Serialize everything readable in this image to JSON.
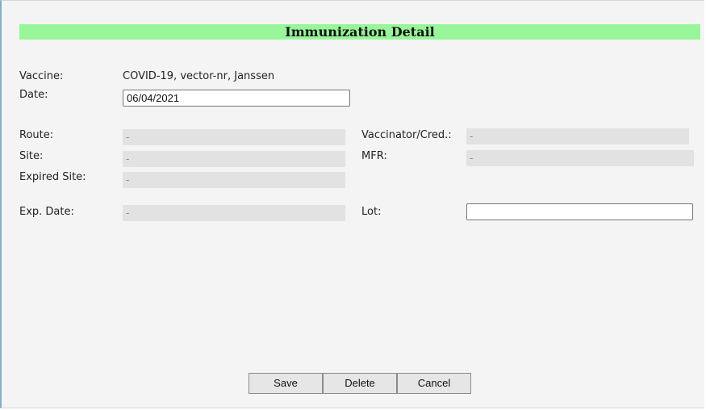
{
  "form": {
    "title": "Immunization Detail",
    "vaccine": {
      "label": "Vaccine:",
      "value": "COVID-19, vector-nr, Janssen"
    },
    "date": {
      "label": "Date:",
      "value": "06/04/2021"
    },
    "route": {
      "label": "Route:",
      "value": "-"
    },
    "site": {
      "label": "Site:",
      "value": "-"
    },
    "expired_site": {
      "label": "Expired Site:",
      "value": "-"
    },
    "exp_date": {
      "label": "Exp. Date:",
      "value": "-"
    },
    "vaccinator": {
      "label": "Vaccinator/Cred.:",
      "value": "-"
    },
    "mfr": {
      "label": "MFR:",
      "value": "-"
    },
    "lot": {
      "label": "Lot:",
      "value": ""
    }
  },
  "buttons": {
    "save": "Save",
    "delete": "Delete",
    "cancel": "Cancel"
  }
}
